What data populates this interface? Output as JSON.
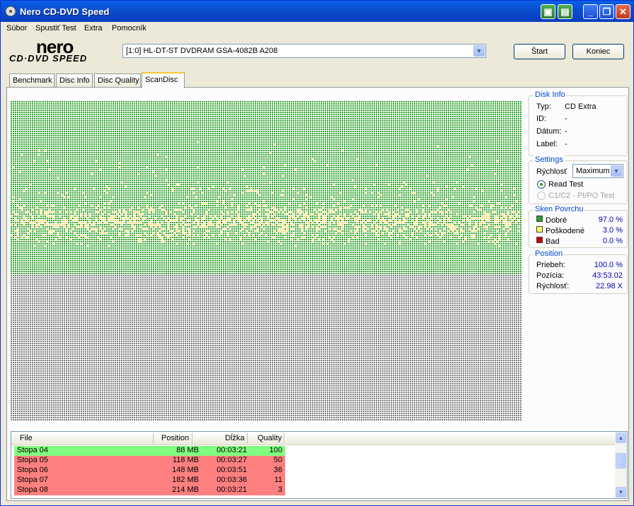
{
  "window": {
    "title": "Nero CD-DVD Speed"
  },
  "menu": [
    "Súbor",
    "Spustiť Test",
    "Extra",
    "Pomocník"
  ],
  "logo": {
    "line1": "nero",
    "line2": "CD·DVD SPEED"
  },
  "drive": {
    "selected": "[1:0]  HL-DT-ST DVDRAM GSA-4082B A208"
  },
  "buttons": {
    "start": "Štart",
    "exit": "Koniec"
  },
  "tabs": [
    {
      "label": "Benchmark",
      "active": false
    },
    {
      "label": "Disc Info",
      "active": false
    },
    {
      "label": "Disc Quality",
      "active": false
    },
    {
      "label": "ScanDisc",
      "active": true
    }
  ],
  "scan_map": {
    "colors": {
      "good": "#2ca02c",
      "damaged": "#ffd966",
      "bad": "#cc0000",
      "unscanned": "#7a7a7a"
    }
  },
  "disk_info": {
    "title": "Disk Info",
    "rows": [
      {
        "label": "Typ:",
        "value": "CD Extra"
      },
      {
        "label": "ID:",
        "value": "-"
      },
      {
        "label": "Dátum:",
        "value": "-"
      },
      {
        "label": "Label:",
        "value": "-"
      }
    ]
  },
  "settings": {
    "title": "Settings",
    "speed_label": "Rýchlosť",
    "speed_value": "Maximum",
    "radio_read": "Read Test",
    "radio_c1c2": "C1/C2 - PI/PO Test"
  },
  "surface": {
    "title": "Sken Povrchu",
    "rows": [
      {
        "label": "Dobré",
        "value": "97.0 %",
        "color": "#2ca02c"
      },
      {
        "label": "Poškodené",
        "value": "3.0 %",
        "color": "#ffff66"
      },
      {
        "label": "Bad",
        "value": "0.0 %",
        "color": "#cc0000"
      }
    ]
  },
  "position": {
    "title": "Position",
    "rows": [
      {
        "label": "Priebeh:",
        "value": "100.0 %"
      },
      {
        "label": "Pozícia:",
        "value": "43:53.02"
      },
      {
        "label": "Rýchlosť:",
        "value": "22.98 X"
      }
    ]
  },
  "file_list": {
    "headers": [
      "File",
      "Position",
      "Dĺžka",
      "Quality"
    ],
    "rows": [
      {
        "file": "Stopa 04",
        "position": "88 MB",
        "length": "00:03:21",
        "quality": "100",
        "color": "#80ff80"
      },
      {
        "file": "Stopa 05",
        "position": "118 MB",
        "length": "00:03:27",
        "quality": "50",
        "color": "#ff8080"
      },
      {
        "file": "Stopa 06",
        "position": "148 MB",
        "length": "00:03:51",
        "quality": "36",
        "color": "#ff8080"
      },
      {
        "file": "Stopa 07",
        "position": "182 MB",
        "length": "00:03:36",
        "quality": "11",
        "color": "#ff8080"
      },
      {
        "file": "Stopa 08",
        "position": "214 MB",
        "length": "00:03:21",
        "quality": "3",
        "color": "#ff8080"
      }
    ]
  }
}
